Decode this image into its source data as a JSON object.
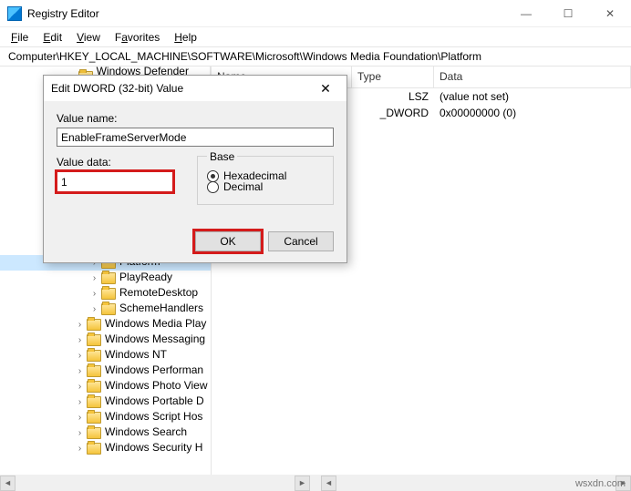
{
  "window": {
    "title": "Registry Editor",
    "min_icon": "—",
    "max_icon": "☐",
    "close_icon": "✕"
  },
  "menu": {
    "file": "File",
    "edit": "Edit",
    "view": "View",
    "favorites": "Favorites",
    "help": "Help"
  },
  "address": {
    "label": "Computer\\HKEY_LOCAL_MACHINE\\SOFTWARE\\Microsoft\\Windows Media Foundation\\Platform"
  },
  "tree": {
    "top_cut": "Windows Defender S",
    "items": [
      {
        "label": "Platform",
        "indent": 98,
        "sel": true
      },
      {
        "label": "PlayReady",
        "indent": 98,
        "sel": false
      },
      {
        "label": "RemoteDesktop",
        "indent": 98,
        "sel": false
      },
      {
        "label": "SchemeHandlers",
        "indent": 98,
        "sel": false
      },
      {
        "label": "Windows Media Play",
        "indent": 82,
        "sel": false
      },
      {
        "label": "Windows Messaging",
        "indent": 82,
        "sel": false
      },
      {
        "label": "Windows NT",
        "indent": 82,
        "sel": false
      },
      {
        "label": "Windows Performan",
        "indent": 82,
        "sel": false
      },
      {
        "label": "Windows Photo View",
        "indent": 82,
        "sel": false
      },
      {
        "label": "Windows Portable D",
        "indent": 82,
        "sel": false
      },
      {
        "label": "Windows Script Hos",
        "indent": 82,
        "sel": false
      },
      {
        "label": "Windows Search",
        "indent": 82,
        "sel": false
      },
      {
        "label": "Windows Security H",
        "indent": 82,
        "sel": false
      }
    ]
  },
  "list": {
    "cols": {
      "name": "Name",
      "type": "Type",
      "data": "Data"
    },
    "rows": [
      {
        "type_frag": "LSZ",
        "data": "(value not set)"
      },
      {
        "type_frag": "_DWORD",
        "data": "0x00000000 (0)"
      }
    ]
  },
  "dialog": {
    "title": "Edit DWORD (32-bit) Value",
    "close": "✕",
    "value_name_label": "Value name:",
    "value_name": "EnableFrameServerMode",
    "value_data_label": "Value data:",
    "value_data": "1",
    "base_label": "Base",
    "hex": "Hexadecimal",
    "dec": "Decimal",
    "ok": "OK",
    "cancel": "Cancel"
  },
  "watermark": "wsxdn.com"
}
